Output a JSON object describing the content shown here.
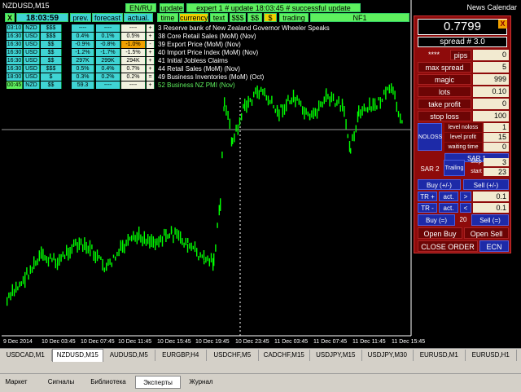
{
  "chart": {
    "symbol": "NZDUSD,M15",
    "x_labels": [
      "9 Dec 2014",
      "10 Dec 03:45",
      "10 Dec 07:45",
      "10 Dec 11:45",
      "10 Dec 15:45",
      "10 Dec 19:45",
      "10 Dec 23:45",
      "11 Dec 03:45",
      "11 Dec 07:45",
      "11 Dec 11:45",
      "11 Dec 15:45"
    ],
    "colors": {
      "candle": "#00ff00",
      "level": "#9a9a9a",
      "grid": "#ffffff"
    }
  },
  "toolbar": {
    "lang": "EN/RU",
    "update": "update",
    "expert_status": "expert 1  #  update 18:03:45  #  successful update",
    "news_calendar": "News Calendar",
    "close_x": "X",
    "time": "18:03:59",
    "prev": "prev.",
    "forecast": "forecast",
    "actual": "actual.",
    "filters": [
      "time",
      "currency",
      "text",
      "$$$",
      "$$",
      "$",
      "trading"
    ],
    "nf": "NF1"
  },
  "news": [
    {
      "time": "03:10",
      "cur": "NZD",
      "imp": "$$$",
      "prev": "----",
      "fc": "----",
      "act": "----",
      "sign": "+",
      "text": "3 Reserve bank of New Zealand Governor Wheeler Speaks"
    },
    {
      "time": "16:30",
      "cur": "USD",
      "imp": "$$$",
      "prev": "0.4%",
      "fc": "0.1%",
      "act": "0.5%",
      "sign": "+",
      "text": "38 Core Retail Sales (MoM) (Nov)"
    },
    {
      "time": "16:30",
      "cur": "USD",
      "imp": "$$",
      "prev": "-0.9%",
      "fc": "-0.8%",
      "act": "-1.0%",
      "sign": "-",
      "text": "39 Export Price (MoM) (Nov)"
    },
    {
      "time": "16:30",
      "cur": "USD",
      "imp": "$$",
      "prev": "-1.2%",
      "fc": "-1.7%",
      "act": "-1.5%",
      "sign": "+",
      "text": "40 Import Price Index (MoM) (Nov)"
    },
    {
      "time": "16:30",
      "cur": "USD",
      "imp": "$$",
      "prev": "297K",
      "fc": "299K",
      "act": "294K",
      "sign": "+",
      "text": "41 Initial Jobless Claims"
    },
    {
      "time": "16:30",
      "cur": "USD",
      "imp": "$$$",
      "prev": "0.5%",
      "fc": "0.4%",
      "act": "0.7%",
      "sign": "+",
      "text": "44 Retail Sales (MoM) (Nov)"
    },
    {
      "time": "18:00",
      "cur": "USD",
      "imp": "$",
      "prev": "0.3%",
      "fc": "0.2%",
      "act": "0.2%",
      "sign": "=",
      "text": "49 Business Inventories (MoM) (Oct)"
    },
    {
      "time": "00:45",
      "cur": "NZD",
      "imp": "$$",
      "prev": "59.3",
      "fc": "----",
      "act": "----",
      "sign": "+",
      "text": "52 Business NZ PMI  (Nov)"
    }
  ],
  "panel": {
    "price": "0.7799",
    "spread": "spread # 3.0",
    "stars": "****",
    "rows": [
      {
        "label": "pips",
        "value": "0"
      },
      {
        "label": "max spread",
        "value": "5"
      },
      {
        "label": "magic",
        "value": "999"
      },
      {
        "label": "lots",
        "value": "0.10"
      },
      {
        "label": "take profit",
        "value": "0"
      },
      {
        "label": "stop loss",
        "value": "100"
      }
    ],
    "noloss": "NOLOSS",
    "level_noloss": "level noloss",
    "level_noloss_val": "1",
    "level_profit": "level profit",
    "level_profit_val": "15",
    "waiting_time": "waiting time",
    "waiting_time_val": "0",
    "sar1": "SAR 1",
    "sar2": "SAR 2",
    "trailing": "Trailing",
    "step": "step",
    "step_val": "3",
    "start": "start",
    "start_val": "23",
    "buy_pm": "Buy  (+/-)",
    "sell_pm": "Sell  (+/-)",
    "tr_plus": "TR +",
    "act": "act.",
    "gt": ">",
    "tr_plus_val": "0.1",
    "tr_minus": "TR -",
    "lt": "<",
    "tr_minus_val": "0.1",
    "buy_eq": "Buy  (=)",
    "eq_val": "20",
    "sell_eq": "Sell  (=)",
    "open_buy": "Open Buy",
    "open_sell": "Open Sell",
    "close_order": "CLOSE ORDER",
    "ecn": "ECN"
  },
  "tabs": [
    "USDCAD,M1",
    "NZDUSD,M15",
    "AUDUSD,M5",
    "EURGBP,H4",
    "USDCHF,M5",
    "CADCHF,M15",
    "USDJPY,M15",
    "USDJPY,M30",
    "EURUSD,M1",
    "EURUSD,H1"
  ],
  "active_tab": "NZDUSD,M15",
  "bottom_tabs": [
    "Маркет",
    "Сигналы",
    "Библиотека",
    "Эксперты",
    "Журнал"
  ],
  "active_bottom_tab": "Эксперты"
}
